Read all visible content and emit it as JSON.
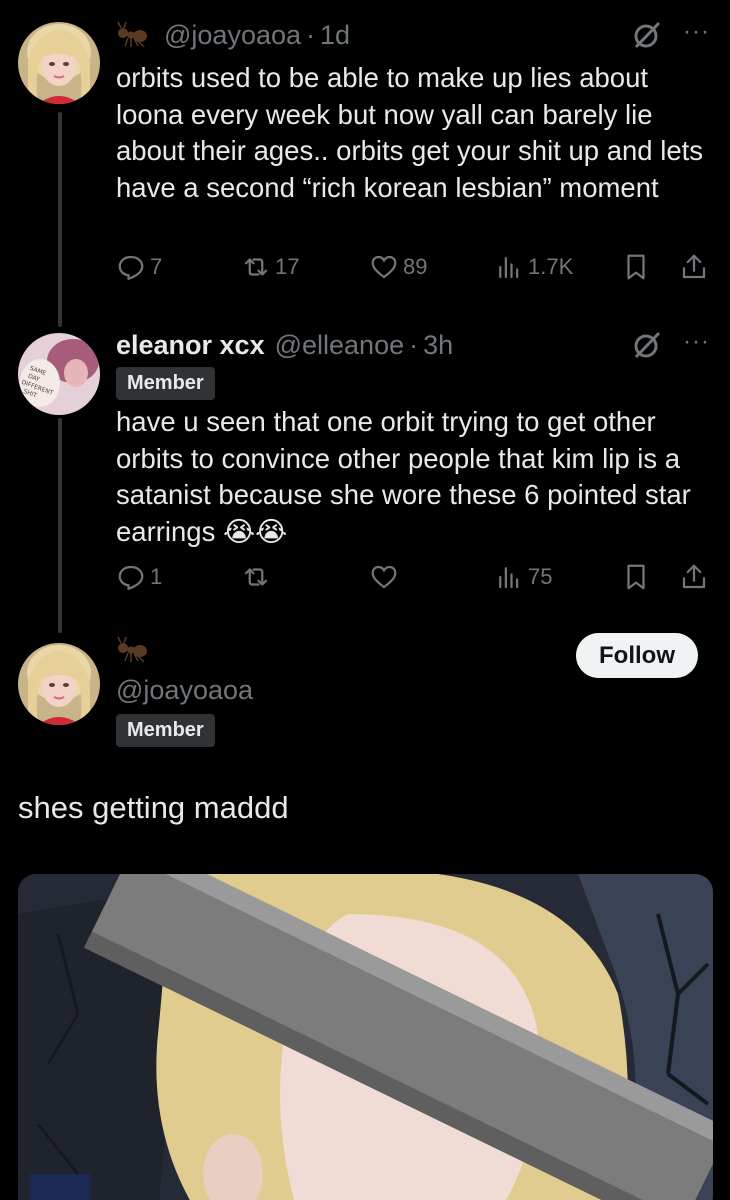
{
  "thread": [
    {
      "display_name": "",
      "handle": "@joayoaoa",
      "time": "1d",
      "text": "orbits used to be able to make up lies about loona every week but now yall can barely lie about their ages.. orbits get your shit up and lets have a second “rich korean lesbian” moment",
      "stats": {
        "replies": "7",
        "reposts": "17",
        "likes": "89",
        "views": "1.7K"
      }
    },
    {
      "display_name": "eleanor xcx",
      "handle": "@elleanoe",
      "time": "3h",
      "badge": "Member",
      "text": "have u seen that one orbit trying to get other orbits to convince other people that kim lip is a satanist because she wore these 6 pointed star earrings 😭😭",
      "stats": {
        "replies": "1",
        "reposts": "",
        "likes": "",
        "views": "75"
      }
    }
  ],
  "main_post": {
    "handle": "@joayoaoa",
    "badge": "Member",
    "follow_label": "Follow",
    "text": "shes getting maddd"
  },
  "separator": "·",
  "more_glyph": "···",
  "colors": {
    "background": "#000000",
    "text": "#e7e9ea",
    "muted": "#71767b",
    "badge_bg": "#2f3336",
    "follow_bg": "#eff3f4"
  },
  "icons": [
    "ant-icon",
    "grok-icon",
    "more-icon",
    "reply-icon",
    "repost-icon",
    "like-icon",
    "views-icon",
    "bookmark-icon",
    "share-icon"
  ]
}
